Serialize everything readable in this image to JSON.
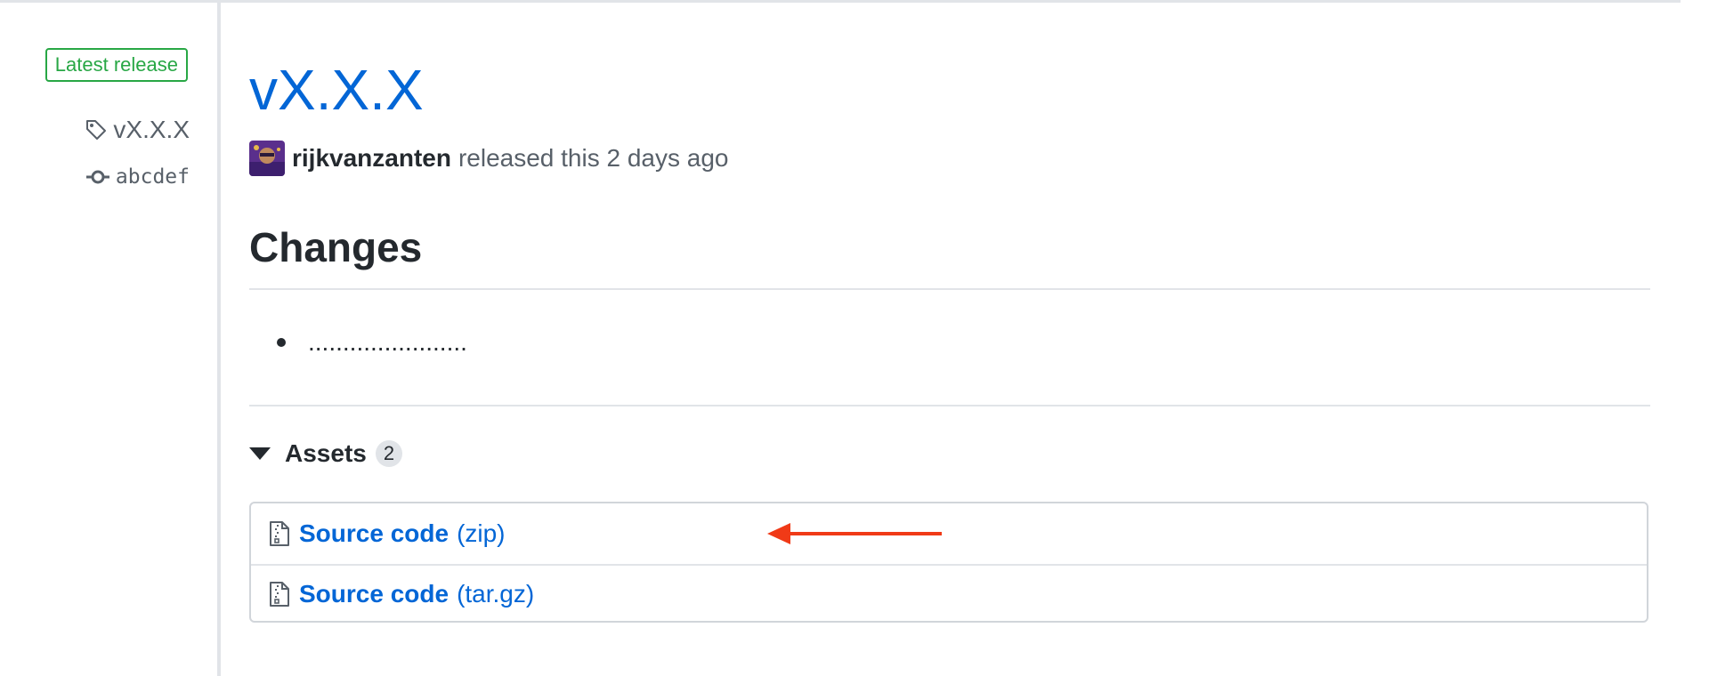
{
  "sidebar": {
    "latest_badge": "Latest release",
    "tag": "vX.X.X",
    "commit": "abcdef"
  },
  "release": {
    "title": "vX.X.X",
    "author": "rijkvanzanten",
    "released_text": "released this 2 days ago"
  },
  "body": {
    "heading": "Changes",
    "items": [
      "......................."
    ]
  },
  "assets": {
    "label": "Assets",
    "count": "2",
    "files": [
      {
        "name": "Source code",
        "ext": "(zip)",
        "icon": "file-zip-icon"
      },
      {
        "name": "Source code",
        "ext": "(tar.gz)",
        "icon": "file-zip-icon"
      }
    ]
  },
  "colors": {
    "link": "#0366d6",
    "badge_green": "#28a745",
    "annotation_arrow": "#f03a17"
  }
}
